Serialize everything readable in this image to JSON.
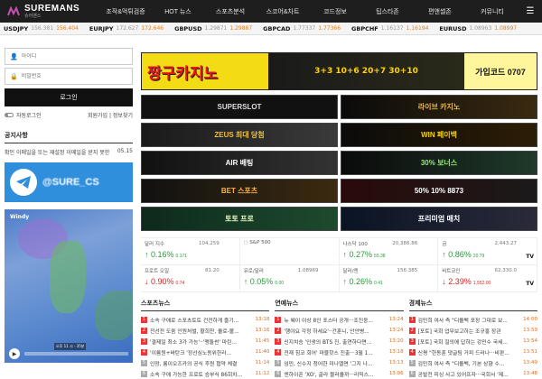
{
  "header": {
    "brand": "SUREMANS",
    "brand_sub": "슈어맨스",
    "nav": [
      "조작&먹튀검증",
      "HOT 뉴스",
      "스포츠분석",
      "스코어&차트",
      "코드정보",
      "팁스타존",
      "편앤썰존",
      "커뮤니티"
    ],
    "menu_icon": "hamburger-icon"
  },
  "ticker": [
    {
      "name": "USDJPY",
      "a": "156.381",
      "b": "156.404"
    },
    {
      "name": "EURJPY",
      "a": "172.627",
      "b": "172.646"
    },
    {
      "name": "GBPUSD",
      "a": "1.29871",
      "b": "1.29887"
    },
    {
      "name": "GBPCAD",
      "a": "1.77337",
      "b": "1.77366"
    },
    {
      "name": "GBPCHF",
      "a": "1.16137",
      "b": "1.16194"
    },
    {
      "name": "EURUSD",
      "a": "1.08963",
      "b": "1.08997"
    }
  ],
  "login": {
    "id_placeholder": "아이디",
    "pw_placeholder": "비밀번호",
    "button": "로그인",
    "auto_login": "자동로그인",
    "links": "회원가입 | 정보찾기"
  },
  "notice": {
    "title": "공지사항",
    "item": "확인 이메일을 또는 재설정 이메일을 받지 못한",
    "date": "05.15"
  },
  "telegram": {
    "text": "@SURE_CS"
  },
  "weather": {
    "logo": "Windy",
    "time": "오후 11 시 - 35분"
  },
  "banners": {
    "top_title": "짱구카지노",
    "top_mid": "3+3 10+6 20+7 30+10",
    "top_right": "가입코드 0707",
    "items": [
      "SUPERSLOT",
      "라이브 카지노",
      "ZEUS 최대 당첨",
      "WIN 페이백",
      "AIR 배팅",
      "30% 보너스",
      "BET 스포츠",
      "50% 10% 8873",
      "토토 프로",
      "프리미엄 매치"
    ]
  },
  "market": [
    {
      "name": "달러 지수",
      "num": "104.259",
      "pct": "0.16%",
      "sub": "0.171",
      "dir": "up",
      "tv": ""
    },
    {
      "name": "S&P 500",
      "num": "",
      "pct": "",
      "sub": "",
      "dir": "up",
      "tv": ""
    },
    {
      "name": "나스닥 100",
      "num": "20,386.86",
      "pct": "0.27%",
      "sub": "55.38",
      "dir": "up",
      "tv": ""
    },
    {
      "name": "금",
      "num": "2,443.27",
      "pct": "0.86%",
      "sub": "20.79",
      "dir": "up",
      "tv": "TV"
    },
    {
      "name": "프로트 오일",
      "num": "81.20",
      "pct": "0.90%",
      "sub": "0.74",
      "dir": "down",
      "tv": ""
    },
    {
      "name": "유로/달러",
      "num": "1.08969",
      "pct": "0.05%",
      "sub": "0.00",
      "dir": "up",
      "tv": ""
    },
    {
      "name": "달러/엔",
      "num": "156.385",
      "pct": "0.26%",
      "sub": "0.41",
      "dir": "up",
      "tv": ""
    },
    {
      "name": "비트코인",
      "num": "62,330.0",
      "pct": "2.39%",
      "sub": "1,552.00",
      "dir": "down",
      "tv": "TV"
    }
  ],
  "news": [
    {
      "title": "스포츠뉴스",
      "items": [
        {
          "n": "1",
          "t": "소속 구애로 스포츠토토 건전하게 즐기...",
          "time": "13:18"
        },
        {
          "n": "2",
          "t": "전선전 도움 인원처벌, 황희찬, 올로-볼...",
          "time": "13:16"
        },
        {
          "n": "3",
          "t": "'결제일 최소 3가 가능'··'맹돌썬' 마린...",
          "time": "11:45"
        },
        {
          "n": "4",
          "t": "'이름원+바탄크 '정선심노동위한라...",
          "time": "11:40"
        },
        {
          "n": "5",
          "t": "인망, 롱이오즈카의 공식 후원 협약 체결",
          "time": "11:14"
        },
        {
          "n": "6",
          "t": "소속 구애 가능한 프로토 승부식 86회차...",
          "time": "11:12"
        }
      ]
    },
    {
      "title": "연예뉴스",
      "items": [
        {
          "n": "1",
          "t": "뉴 웨이 이상 8인 포스터 공개···조진웅...",
          "time": "13:24"
        },
        {
          "n": "2",
          "t": "'행야요 각정 하세요'··건훈니, 안안병...",
          "time": "13:24"
        },
        {
          "n": "3",
          "t": "신지치승 '인생의 BTS 진, 출연하다면...",
          "time": "13:20"
        },
        {
          "n": "4",
          "t": "전재 힘코 회어' 마블핫스 진출···3월 1...",
          "time": "13:18"
        },
        {
          "n": "5",
          "t": "임민, 신수지 청어한 미나엘면 '그지 나...",
          "time": "13:13"
        },
        {
          "n": "6",
          "t": "엔하이픈 'XO', 골라 블러올까···리믹스...",
          "time": "13:06"
        }
      ]
    },
    {
      "title": "경제뉴스",
      "items": [
        {
          "n": "1",
          "t": "김민희 여사 측 \"디올백 포장 그대로 보...",
          "time": "14:00"
        },
        {
          "n": "2",
          "t": "[포토] 국회 업무보고하는 조규홍 장관",
          "time": "13:59"
        },
        {
          "n": "3",
          "t": "[포토] 국회 질의에 답하는 강민수 국세...",
          "time": "13:54"
        },
        {
          "n": "4",
          "t": "신평 \"한동훈 댓글팀 거피 드러나···비판...",
          "time": "13:51"
        },
        {
          "n": "5",
          "t": "김민희 여사 측 \"디올백, 기본 상향 수...",
          "time": "13:49"
        },
        {
          "n": "6",
          "t": "공발전 피싱 사고 있어프자···국회서 '제...",
          "time": "13:48"
        }
      ]
    }
  ]
}
